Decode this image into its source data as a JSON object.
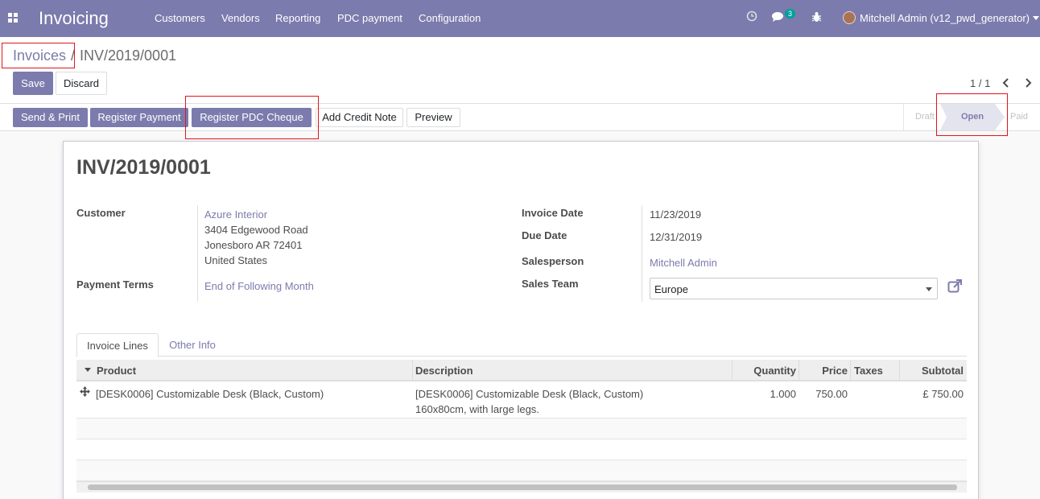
{
  "navbar": {
    "app_name": "Invoicing",
    "menu": [
      "Customers",
      "Vendors",
      "Reporting",
      "PDC payment",
      "Configuration"
    ],
    "messages_count": "3",
    "user": "Mitchell Admin (v12_pwd_generator)"
  },
  "breadcrumb": {
    "parent": "Invoices",
    "separator": "/",
    "current": "INV/2019/0001"
  },
  "toolbar": {
    "save": "Save",
    "discard": "Discard"
  },
  "pager": {
    "value": "1 / 1"
  },
  "actions": [
    "Send & Print",
    "Register Payment",
    "Register PDC Cheque",
    "Add Credit Note",
    "Preview"
  ],
  "stages": {
    "draft": "Draft",
    "open": "Open",
    "paid": "Paid"
  },
  "invoice": {
    "number": "INV/2019/0001",
    "customer_label": "Customer",
    "customer_name": "Azure Interior",
    "address_line1": "3404 Edgewood Road",
    "address_line2": "Jonesboro AR 72401",
    "address_line3": "United States",
    "payment_terms_label": "Payment Terms",
    "payment_terms": "End of Following Month",
    "invoice_date_label": "Invoice Date",
    "invoice_date": "11/23/2019",
    "due_date_label": "Due Date",
    "due_date": "12/31/2019",
    "salesperson_label": "Salesperson",
    "salesperson": "Mitchell Admin",
    "sales_team_label": "Sales Team",
    "sales_team": "Europe"
  },
  "tabs": {
    "lines": "Invoice Lines",
    "other": "Other Info"
  },
  "table": {
    "headers": {
      "product": "Product",
      "description": "Description",
      "quantity": "Quantity",
      "price": "Price",
      "taxes": "Taxes",
      "subtotal": "Subtotal"
    },
    "rows": [
      {
        "product": "[DESK0006] Customizable Desk (Black, Custom)",
        "description_line1": "[DESK0006] Customizable Desk (Black, Custom)",
        "description_line2": "160x80cm, with large legs.",
        "quantity": "1.000",
        "price": "750.00",
        "taxes": "",
        "subtotal": "£ 750.00"
      }
    ]
  },
  "colors": {
    "brand": "#7c7bad",
    "annotation": "#e0151c"
  }
}
